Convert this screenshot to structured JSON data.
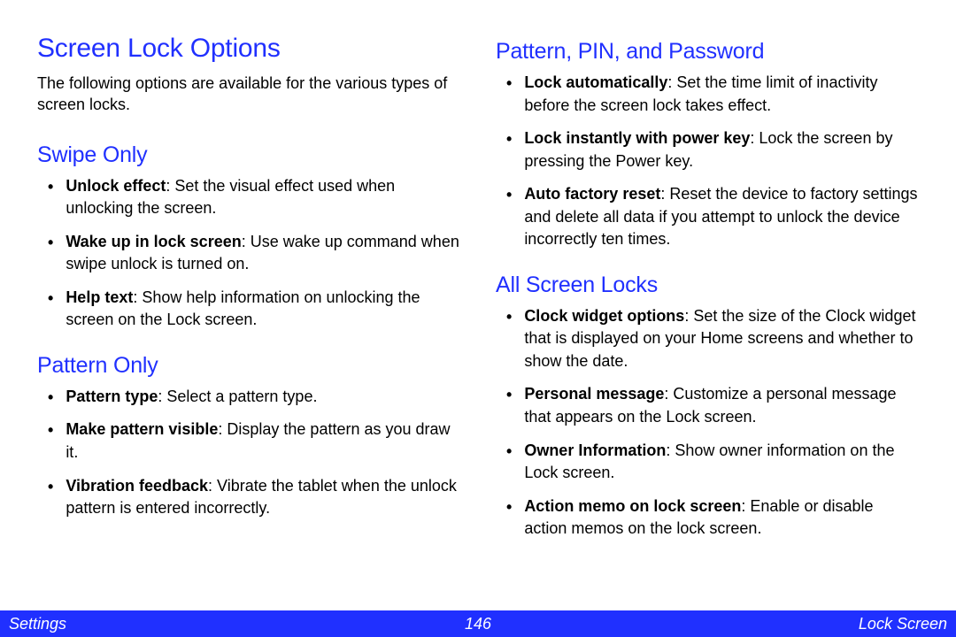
{
  "title": "Screen Lock Options",
  "intro": "The following options are available for the various types of screen locks.",
  "left_sections": [
    {
      "heading": "Swipe Only",
      "items": [
        {
          "term": "Unlock effect",
          "desc": ": Set the visual effect used when unlocking the screen."
        },
        {
          "term": "Wake up in lock screen",
          "desc": ": Use wake up command when swipe unlock is turned on."
        },
        {
          "term": "Help text",
          "desc": ": Show help information on unlocking the screen on the Lock screen."
        }
      ]
    },
    {
      "heading": "Pattern Only",
      "items": [
        {
          "term": "Pattern type",
          "desc": ": Select a pattern type."
        },
        {
          "term": "Make pattern visible",
          "desc": ": Display the pattern as you draw it."
        },
        {
          "term": "Vibration feedback",
          "desc": ": Vibrate the tablet when the unlock pattern is entered incorrectly."
        }
      ]
    }
  ],
  "right_sections": [
    {
      "heading": "Pattern, PIN, and Password",
      "items": [
        {
          "term": "Lock automatically",
          "desc": ": Set the time limit of inactivity before the screen lock takes effect."
        },
        {
          "term": "Lock instantly with power key",
          "desc": ": Lock the screen by pressing the Power key."
        },
        {
          "term": "Auto factory reset",
          "desc": ": Reset the device to factory settings and delete all data if you attempt to unlock the device incorrectly ten times."
        }
      ]
    },
    {
      "heading": "All Screen Locks",
      "items": [
        {
          "term": "Clock widget options",
          "desc": ": Set the size of the Clock widget that is displayed on your Home screens and whether to show the date."
        },
        {
          "term": "Personal message",
          "desc": ": Customize a personal message that appears on the Lock screen."
        },
        {
          "term": "Owner Information",
          "desc": ": Show owner information on the Lock screen."
        },
        {
          "term": "Action memo on lock screen",
          "desc": ": Enable or disable action memos on the lock screen."
        }
      ]
    }
  ],
  "footer": {
    "left": "Settings",
    "center": "146",
    "right": "Lock Screen"
  }
}
